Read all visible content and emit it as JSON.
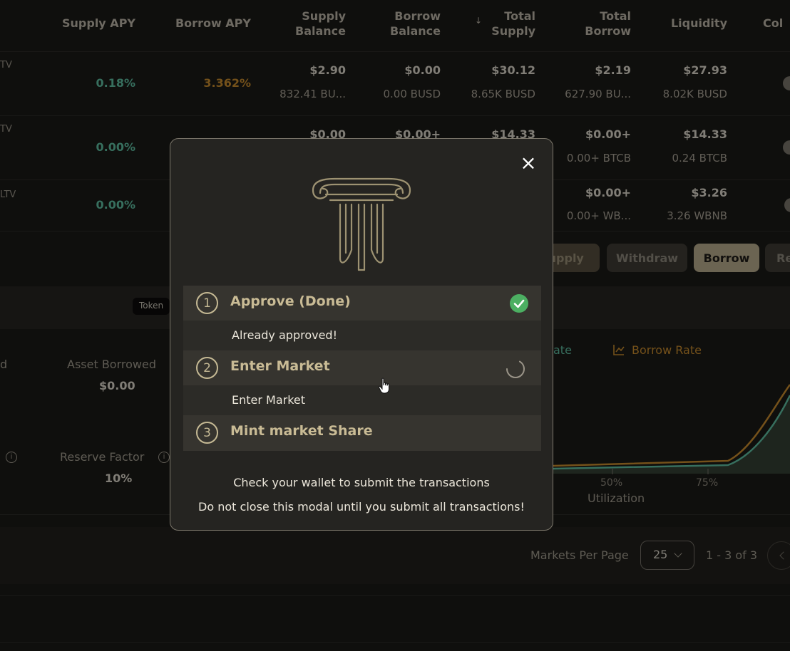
{
  "table": {
    "headers": {
      "supply_apy": "Supply APY",
      "borrow_apy": "Borrow APY",
      "supply_balance": [
        "Supply",
        "Balance"
      ],
      "borrow_balance": [
        "Borrow",
        "Balance"
      ],
      "total_supply": [
        "Total",
        "Supply"
      ],
      "sort_icon": "↓",
      "total_borrow": [
        "Total",
        "Borrow"
      ],
      "liquidity": "Liquidity",
      "collateral_partial": "Col"
    },
    "rows": [
      {
        "ltv": "TV",
        "supply_apy": "0.18%",
        "borrow_apy": "3.362%",
        "supply_balance": [
          "$2.90",
          "832.41 BU..."
        ],
        "borrow_balance": [
          "$0.00",
          "0.00 BUSD"
        ],
        "total_supply": [
          "$30.12",
          "8.65K BUSD"
        ],
        "total_borrow": [
          "$2.19",
          "627.90 BU..."
        ],
        "liquidity": [
          "$27.93",
          "8.02K BUSD"
        ]
      },
      {
        "ltv": "TV",
        "supply_apy": "0.00%",
        "supply_balance": [
          "$0.00"
        ],
        "borrow_balance": [
          "$0.00+"
        ],
        "total_supply": [
          "$14.33"
        ],
        "total_borrow": [
          "$0.00+",
          "0.00+ BTCB"
        ],
        "liquidity": [
          "$14.33",
          "0.24 BTCB"
        ]
      },
      {
        "ltv": "LTV",
        "supply_apy": "0.00%",
        "total_borrow": [
          "$0.00+",
          "0.00+ WB..."
        ],
        "liquidity": [
          "$3.26",
          "3.26 WBNB"
        ]
      }
    ]
  },
  "actions": {
    "supply": "Supply",
    "withdraw": "Withdraw",
    "borrow": "Borrow",
    "repay_partial": "Re"
  },
  "details": {
    "token_tag": "Token",
    "left_partial": "d",
    "asset_borrowed_label": "Asset Borrowed",
    "asset_borrowed_value": "$0.00",
    "reserve_factor_label": "Reserve Factor",
    "reserve_factor_value": "10%",
    "info_icon": "i"
  },
  "chart": {
    "legend_supply_partial": "ate",
    "legend_borrow": "Borrow Rate",
    "tick_50": "50%",
    "tick_75": "75%",
    "xlabel": "Utilization"
  },
  "pagination": {
    "label": "Markets Per Page",
    "per_page": "25",
    "range": "1 - 3 of 3"
  },
  "modal": {
    "close_icon": "×",
    "steps": [
      {
        "number": "1",
        "title": "Approve (Done)",
        "subtitle": "Already approved!",
        "status": "done"
      },
      {
        "number": "2",
        "title": "Enter Market",
        "subtitle": "Enter Market",
        "status": "loading"
      },
      {
        "number": "3",
        "title": "Mint market Share",
        "status": "pending"
      }
    ],
    "message_1": "Check your wallet to submit the transactions",
    "message_2": "Do not close this modal until you submit all transactions!"
  },
  "colors": {
    "background": "#1b1a17",
    "gold": "#c9bb95",
    "green": "#5fbfa3",
    "orange": "#c98c2e",
    "success": "#4caf62"
  }
}
